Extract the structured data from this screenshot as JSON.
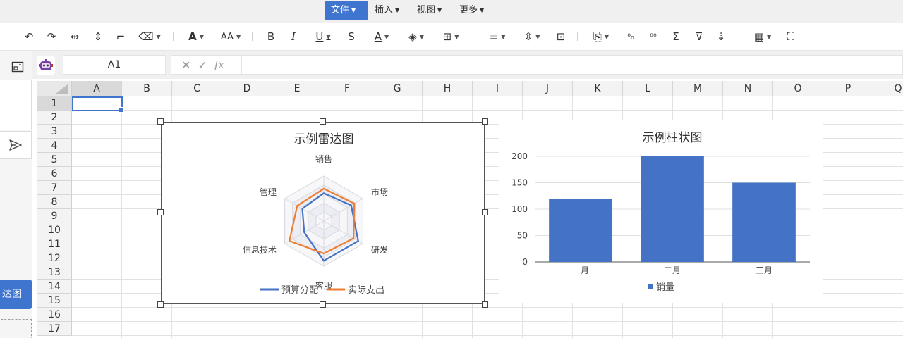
{
  "menu": {
    "items": [
      {
        "label": "文件",
        "active": true
      },
      {
        "label": "插入",
        "active": false
      },
      {
        "label": "视图",
        "active": false
      },
      {
        "label": "更多",
        "active": false
      }
    ]
  },
  "toolbar": {
    "font_color_glyph": "A",
    "font_size_glyph": "AA",
    "bold_glyph": "B",
    "italic_glyph": "I",
    "underline_glyph": "U",
    "strike_glyph": "S",
    "text_color_glyph": "A",
    "sum_glyph": "Σ"
  },
  "sidebar": {
    "button_label": "达图"
  },
  "formula_bar": {
    "cell_ref": "A1",
    "cancel_glyph": "✕",
    "confirm_glyph": "✓",
    "fx_glyph": "fx",
    "formula": ""
  },
  "grid": {
    "columns": [
      "A",
      "B",
      "C",
      "D",
      "E",
      "F",
      "G",
      "H",
      "I",
      "J",
      "K",
      "L",
      "M",
      "N",
      "O",
      "P",
      "Q"
    ],
    "rows": [
      "1",
      "2",
      "3",
      "4",
      "5",
      "6",
      "7",
      "8",
      "9",
      "10",
      "11",
      "12",
      "13",
      "14",
      "15",
      "16",
      "17"
    ],
    "selected_column": "A",
    "selected_row": "1"
  },
  "chart_data": [
    {
      "type": "radar",
      "title": "示例雷达图",
      "indicators": [
        "销售",
        "市场",
        "研发",
        "客服",
        "信息技术",
        "管理"
      ],
      "max": 100,
      "series": [
        {
          "name": "预算分配",
          "color": "#4472c4",
          "values": [
            62,
            70,
            88,
            88,
            50,
            55
          ]
        },
        {
          "name": "实际支出",
          "color": "#ed7d31",
          "values": [
            72,
            78,
            76,
            72,
            88,
            68
          ]
        }
      ],
      "legend_position": "bottom"
    },
    {
      "type": "bar",
      "title": "示例柱状图",
      "categories": [
        "一月",
        "二月",
        "三月"
      ],
      "series": [
        {
          "name": "销量",
          "color": "#4472c4",
          "values": [
            120,
            200,
            150
          ]
        }
      ],
      "yticks": [
        0,
        50,
        100,
        150,
        200
      ],
      "ylim": [
        0,
        200
      ],
      "grid": true,
      "legend_position": "bottom"
    }
  ]
}
